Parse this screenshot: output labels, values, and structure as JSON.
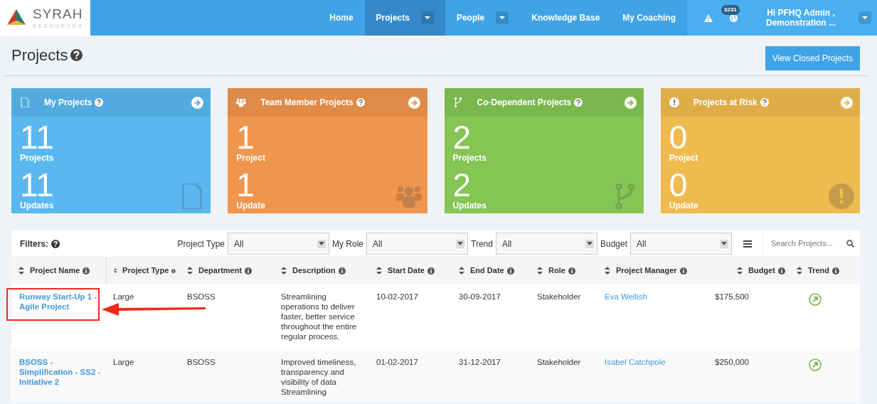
{
  "logo": {
    "name": "SYRAH",
    "subtitle": "RESOURCES"
  },
  "nav": [
    {
      "label": "Home",
      "selected": false,
      "dropdown": false
    },
    {
      "label": "Projects",
      "selected": true,
      "dropdown": true
    },
    {
      "label": "People",
      "selected": false,
      "dropdown": true
    },
    {
      "label": "Knowledge Base",
      "selected": false,
      "dropdown": false
    },
    {
      "label": "My Coaching",
      "selected": false,
      "dropdown": false
    }
  ],
  "notifications": {
    "badge": "3231"
  },
  "user": {
    "greeting": "Hi PFHQ Admin ,",
    "organisation": "Demonstration ..."
  },
  "page": {
    "title": "Projects",
    "action": "View Closed Projects"
  },
  "cards": [
    {
      "kind": "file",
      "title": "My Projects",
      "color": "#5ab7f0",
      "projects": "11",
      "projects_label": "Projects",
      "updates": "11",
      "updates_label": "Updates"
    },
    {
      "kind": "team",
      "title": "Team Member Projects",
      "color": "#f0954d",
      "projects": "1",
      "projects_label": "Project",
      "updates": "1",
      "updates_label": "Update"
    },
    {
      "kind": "branch",
      "title": "Co-Dependent Projects",
      "color": "#84c554",
      "projects": "2",
      "projects_label": "Projects",
      "updates": "2",
      "updates_label": "Updates"
    },
    {
      "kind": "risk",
      "title": "Projects at Risk",
      "color": "#f0bb4e",
      "projects": "0",
      "projects_label": "Project",
      "updates": "0",
      "updates_label": "Update"
    }
  ],
  "filters": {
    "label": "Filters:",
    "fields": [
      {
        "label": "Project Type",
        "value": "All"
      },
      {
        "label": "My Role",
        "value": "All"
      },
      {
        "label": "Trend",
        "value": "All"
      },
      {
        "label": "Budget",
        "value": "All"
      }
    ],
    "search": {
      "placeholder": "Search Projects..."
    }
  },
  "table": {
    "columns": [
      "Project Name",
      "Project Type",
      "Department",
      "Description",
      "Start Date",
      "End Date",
      "Role",
      "Project Manager",
      "Budget",
      "Trend"
    ],
    "rows": [
      {
        "name": "Runway Start-Up 1 - Agile Project",
        "type": "Large",
        "department": "BSOSS",
        "description": "Streamlining operations to deliver faster, better service throughout the entire regular process.",
        "start": "10-02-2017",
        "end": "30-09-2017",
        "role": "Stakeholder",
        "manager": "Eva Wellish",
        "budget": "$175,500",
        "trending_up": true,
        "highlighted": true
      },
      {
        "name": "BSOSS - Simplification - SS2 - Initiative 2",
        "type": "Large",
        "department": "BSOSS",
        "description": "Improved timeliness, transparency and visibility of data Streamlining",
        "start": "01-02-2017",
        "end": "31-12-2017",
        "role": "Stakeholder",
        "manager": "Isabel Catchpole",
        "budget": "$250,000",
        "trending_up": true,
        "highlighted": false
      }
    ]
  }
}
